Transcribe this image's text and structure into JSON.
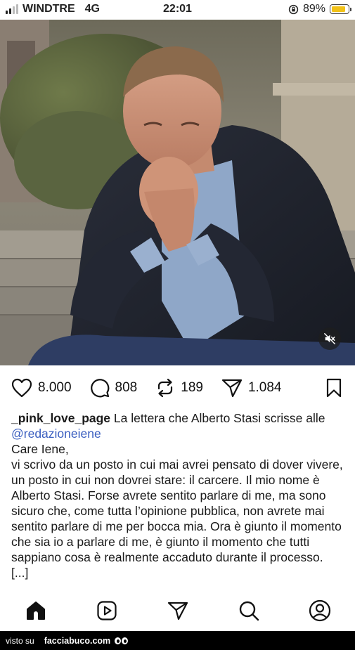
{
  "status_bar": {
    "carrier": "WINDTRE",
    "network": "4G",
    "time": "22:01",
    "battery": "89%",
    "battery_level": 0.89,
    "battery_color": "#f2c218"
  },
  "post": {
    "media_icon": "mute-icon",
    "likes": "8.000",
    "comments": "808",
    "reposts": "189",
    "shares": "1.084",
    "caption": {
      "username": "_pink_love_page",
      "text": "La lettera che Alberto Stasi scrisse alle",
      "mention": "@redazioneiene",
      "greeting": "Care Iene,",
      "body": "vi scrivo da un posto in cui mai avrei pensato di dover vivere, un posto in cui non dovrei stare: il carcere. Il mio nome è Alberto Stasi. Forse avrete sentito parlare di me, ma sono sicuro che, come tutta l’opinione pubblica, non avrete mai sentito parlare di me per bocca mia. Ora è giunto il momento che sia io a parlare di me, è giunto il momento che tutti sappiano cosa è realmente accaduto durante il processo. [...]"
    }
  },
  "bottom_nav": [
    "home-icon",
    "reels-icon",
    "send-icon",
    "search-icon",
    "profile-icon"
  ],
  "watermark": {
    "prefix": "visto su",
    "site": "facciabuco.com"
  },
  "colors": {
    "mention": "#3b5fc0",
    "text": "#1a1a1a"
  }
}
